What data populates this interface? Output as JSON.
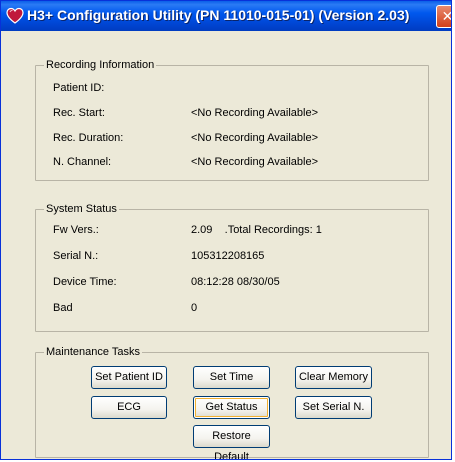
{
  "window": {
    "title": "H3+ Configuration Utility (PN 11010-015-01) (Version 2.03)",
    "close_glyph": "✕"
  },
  "recording": {
    "legend": "Recording Information",
    "rows": [
      {
        "label": "Patient ID:",
        "value": ""
      },
      {
        "label": "Rec. Start:",
        "value": "<No Recording Available>"
      },
      {
        "label": "Rec. Duration:",
        "value": "<No Recording Available>"
      },
      {
        "label": "N. Channel:",
        "value": "<No Recording Available>"
      }
    ]
  },
  "status": {
    "legend": "System Status",
    "rows": [
      {
        "label": "Fw Vers.:",
        "value": "2.09    .Total Recordings: 1"
      },
      {
        "label": "Serial N.:",
        "value": "105312208165"
      },
      {
        "label": "Device Time:",
        "value": "08:12:28 08/30/05"
      },
      {
        "label": "Bad",
        "value": "0"
      }
    ]
  },
  "maintenance": {
    "legend": "Maintenance Tasks",
    "buttons": {
      "set_patient_id": "Set Patient ID",
      "set_time": "Set Time",
      "clear_memory": "Clear Memory",
      "ecg": "ECG",
      "get_status": "Get Status",
      "set_serial": "Set Serial N.",
      "restore_default": "Restore Default"
    }
  },
  "colors": {
    "titlebar": "#0058ee",
    "window_bg": "#ece9d8",
    "close_button": "#d2401a",
    "heart_icon": "#c0183c"
  },
  "icons": {
    "app_icon": "heart-icon",
    "close": "close-icon"
  }
}
